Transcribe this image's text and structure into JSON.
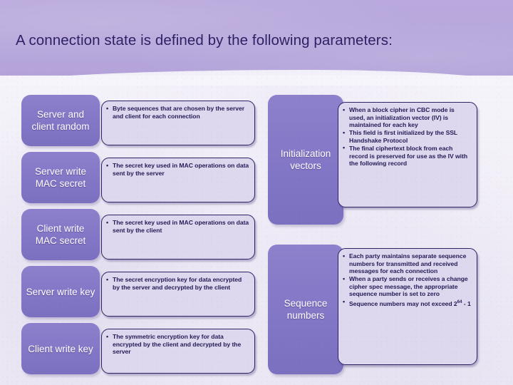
{
  "slide": {
    "title": "A connection state is defined by the following parameters:",
    "colors": {
      "band": "#b9a9dd",
      "label_box": "#8276c6",
      "bullet_box_fill": "#ddd8ee",
      "bullet_box_border": "#2b2163",
      "title_text": "#2d1f63",
      "body_text": "#231a55",
      "label_text": "#ffffff"
    }
  },
  "left_column": {
    "rows": [
      {
        "label": "Server and client random",
        "bullets": [
          "Byte sequences that are chosen by the server and client for each connection"
        ]
      },
      {
        "label": "Server write MAC secret",
        "bullets": [
          "The secret key used in MAC operations on data sent by the server"
        ]
      },
      {
        "label": "Client write MAC secret",
        "bullets": [
          "The secret key used in MAC operations on data sent by the client"
        ]
      },
      {
        "label": "Server write key",
        "bullets": [
          "The secret encryption key for data encrypted by the server and decrypted by the client"
        ]
      },
      {
        "label": "Client write key",
        "bullets": [
          "The symmetric encryption key for data encrypted by the client and decrypted by the server"
        ]
      }
    ]
  },
  "right_column": {
    "rows": [
      {
        "label": "Initialization vectors",
        "bullets": [
          "When a block cipher in CBC mode is used, an initialization vector (IV) is maintained for each key",
          "This field is first initialized by the SSL Handshake Protocol",
          "The final ciphertext block from each record is preserved for use as the IV with the following record"
        ]
      },
      {
        "label": "Sequence numbers",
        "bullets": [
          "Each party maintains separate sequence numbers for transmitted and received messages for each connection",
          "When a party sends or receives a change cipher spec message, the appropriate sequence number is set to zero",
          "Sequence numbers may not exceed 2^64 - 1"
        ],
        "bullet_3_prefix": "Sequence numbers may not exceed 2",
        "bullet_3_sup": "64",
        "bullet_3_suffix": " - 1"
      }
    ]
  }
}
